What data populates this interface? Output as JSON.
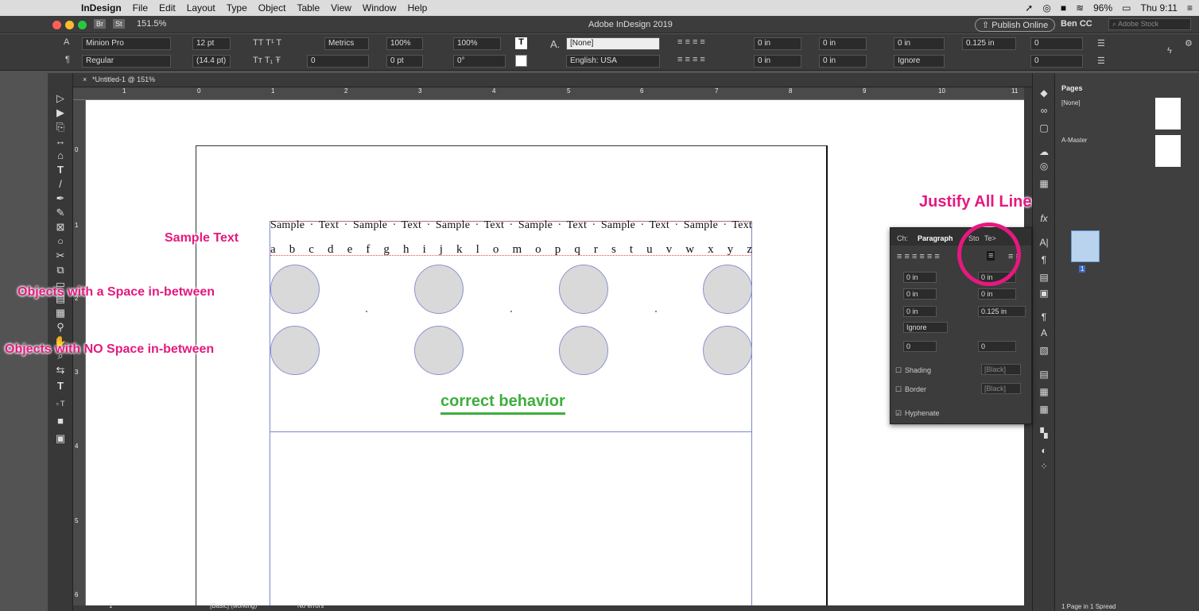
{
  "menubar": {
    "app": "InDesign",
    "items": [
      "File",
      "Edit",
      "Layout",
      "Type",
      "Object",
      "Table",
      "View",
      "Window",
      "Help"
    ],
    "battery": "96%",
    "clock": "Thu 9:11"
  },
  "titlebar": {
    "zoom": "151.5%",
    "title": "Adobe InDesign 2019",
    "publish": "Publish Online",
    "user": "Ben CC",
    "search_placeholder": "Adobe Stock"
  },
  "control": {
    "font": "Minion Pro",
    "style": "Regular",
    "size": "12 pt",
    "leading": "(14.4 pt)",
    "kerning": "Metrics",
    "tracking": "0",
    "vscale": "100%",
    "hscale": "100%",
    "baseline": "0 pt",
    "skew": "0°",
    "char_style": "[None]",
    "language": "English: USA",
    "indent_left": "0 in",
    "indent_first": "0 in",
    "indent_right": "0 in",
    "indent_last": "0 in",
    "space_before": "0 in",
    "space_after": "0.125 in",
    "drop_lines": "0",
    "drop_chars": "0",
    "grid": "Ignore"
  },
  "doc": {
    "tab": "*Untitled-1 @ 151%"
  },
  "ruler": {
    "top": [
      "1",
      "0",
      "1",
      "2",
      "3",
      "4",
      "5",
      "6",
      "7",
      "8",
      "9",
      "10",
      "11"
    ],
    "left": [
      "0",
      "1",
      "2",
      "3",
      "4",
      "5",
      "6"
    ]
  },
  "canvas": {
    "sample_line": "Sample · Text · Sample · Text · Sample · Text · Sample · Text · Sample · Text · Sample · Text",
    "alphabet": "a b c d e f g h i j k l o m o p q r s t u v w x y z"
  },
  "annotations": {
    "justify": "Justify All Lines",
    "sample_text": "Sample Text",
    "with_space": "Objects with a Space in-between",
    "no_space": "Objects with NO Space in-between",
    "correct": "correct behavior"
  },
  "paragraph_panel": {
    "tabs": [
      "Ch:",
      "Paragraph",
      "Sto",
      "Te>"
    ],
    "left_indent": "0 in",
    "right_indent": "0 in",
    "first_indent": "0 in",
    "last_indent": "0 in",
    "space_before": "0 in",
    "space_after": "0.125 in",
    "align_grid": "Ignore",
    "drop_lines": "0",
    "drop_chars": "0",
    "shading": "Shading",
    "shading_color": "[Black]",
    "border": "Border",
    "border_color": "[Black]",
    "hyphenate": "Hyphenate"
  },
  "pages_panel": {
    "title": "Pages",
    "none": "[None]",
    "master": "A-Master",
    "page_number": "1",
    "status": "1 Page in 1 Spread"
  },
  "status": {
    "page": "1",
    "mode": "[Basic] (working)",
    "errors": "No errors"
  },
  "colors": {
    "accent": "#e4197f",
    "correct": "#3eae3e"
  }
}
